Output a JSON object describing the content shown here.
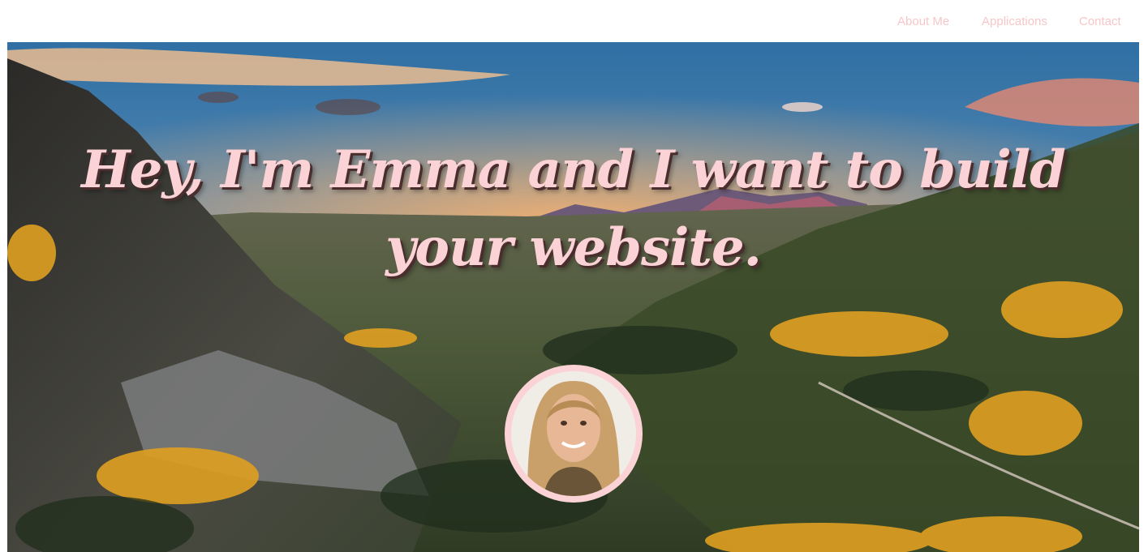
{
  "nav": {
    "items": [
      {
        "label": "About Me"
      },
      {
        "label": "Applications"
      },
      {
        "label": "Contact"
      }
    ],
    "color": "#f8c6c9"
  },
  "hero": {
    "headline": "Hey, I'm Emma and I want to build your website.",
    "headline_color": "#fbd3d6",
    "background_image": "mountain-valley-autumn-sunset",
    "avatar_image": "profile-photo"
  }
}
